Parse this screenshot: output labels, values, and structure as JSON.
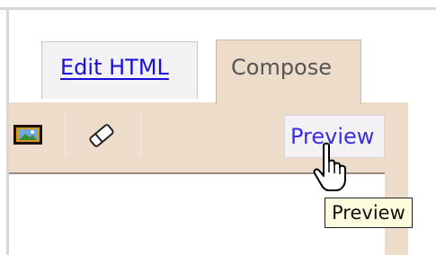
{
  "tabs": {
    "edit_html": {
      "label": "Edit HTML",
      "selected": false
    },
    "compose": {
      "label": "Compose",
      "selected": true
    }
  },
  "toolbar": {
    "image_icon": "image-icon",
    "eraser_icon": "eraser-icon",
    "preview_label": "Preview"
  },
  "tooltip": {
    "text": "Preview"
  },
  "cursor": {
    "icon": "hand-pointer-icon"
  },
  "colors": {
    "link": "#1a0fd8",
    "compose_bg": "#ecdcc9",
    "tooltip_bg": "#fcfcdc"
  }
}
